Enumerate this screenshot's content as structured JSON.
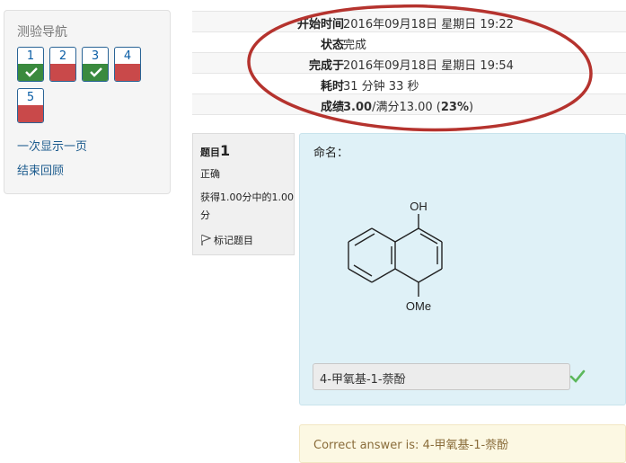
{
  "nav": {
    "title": "测验导航",
    "questions": [
      {
        "number": "1",
        "state": "correct"
      },
      {
        "number": "2",
        "state": "wrong"
      },
      {
        "number": "3",
        "state": "correct"
      },
      {
        "number": "4",
        "state": "wrong"
      },
      {
        "number": "5",
        "state": "wrong"
      }
    ],
    "links": [
      "一次显示一页",
      "结束回顾"
    ]
  },
  "summary": {
    "rows": [
      {
        "label": "开始时间",
        "value": "2016年09月18日 星期日 19:22"
      },
      {
        "label": "状态",
        "value": "完成"
      },
      {
        "label": "完成于",
        "value": "2016年09月18日 星期日 19:54"
      },
      {
        "label": "耗时",
        "value": "31 分钟 33 秒"
      },
      {
        "label": "成绩",
        "value_bold": "3.00",
        "value_mid": "/满分13.00 (",
        "value_pct": "23%",
        "value_end": ")"
      }
    ]
  },
  "question": {
    "label": "题目",
    "number": "1",
    "status": "正确",
    "grade": "获得1.00分中的1.00分",
    "flag_label": "标记题目",
    "prompt": "命名：",
    "molecule": {
      "top_group": "OH",
      "bottom_group": "OMe"
    },
    "answer": "4-甲氧基-1-萘酚",
    "correct_answer": "Correct answer is: 4-甲氧基-1-萘酚"
  },
  "colors": {
    "correct": "#3a8a3e",
    "wrong": "#c9494a",
    "link": "#1d5c8e",
    "annotation": "#b5332e",
    "content_bg": "#dff1f7",
    "feedback_bg": "#fcf8e3"
  }
}
